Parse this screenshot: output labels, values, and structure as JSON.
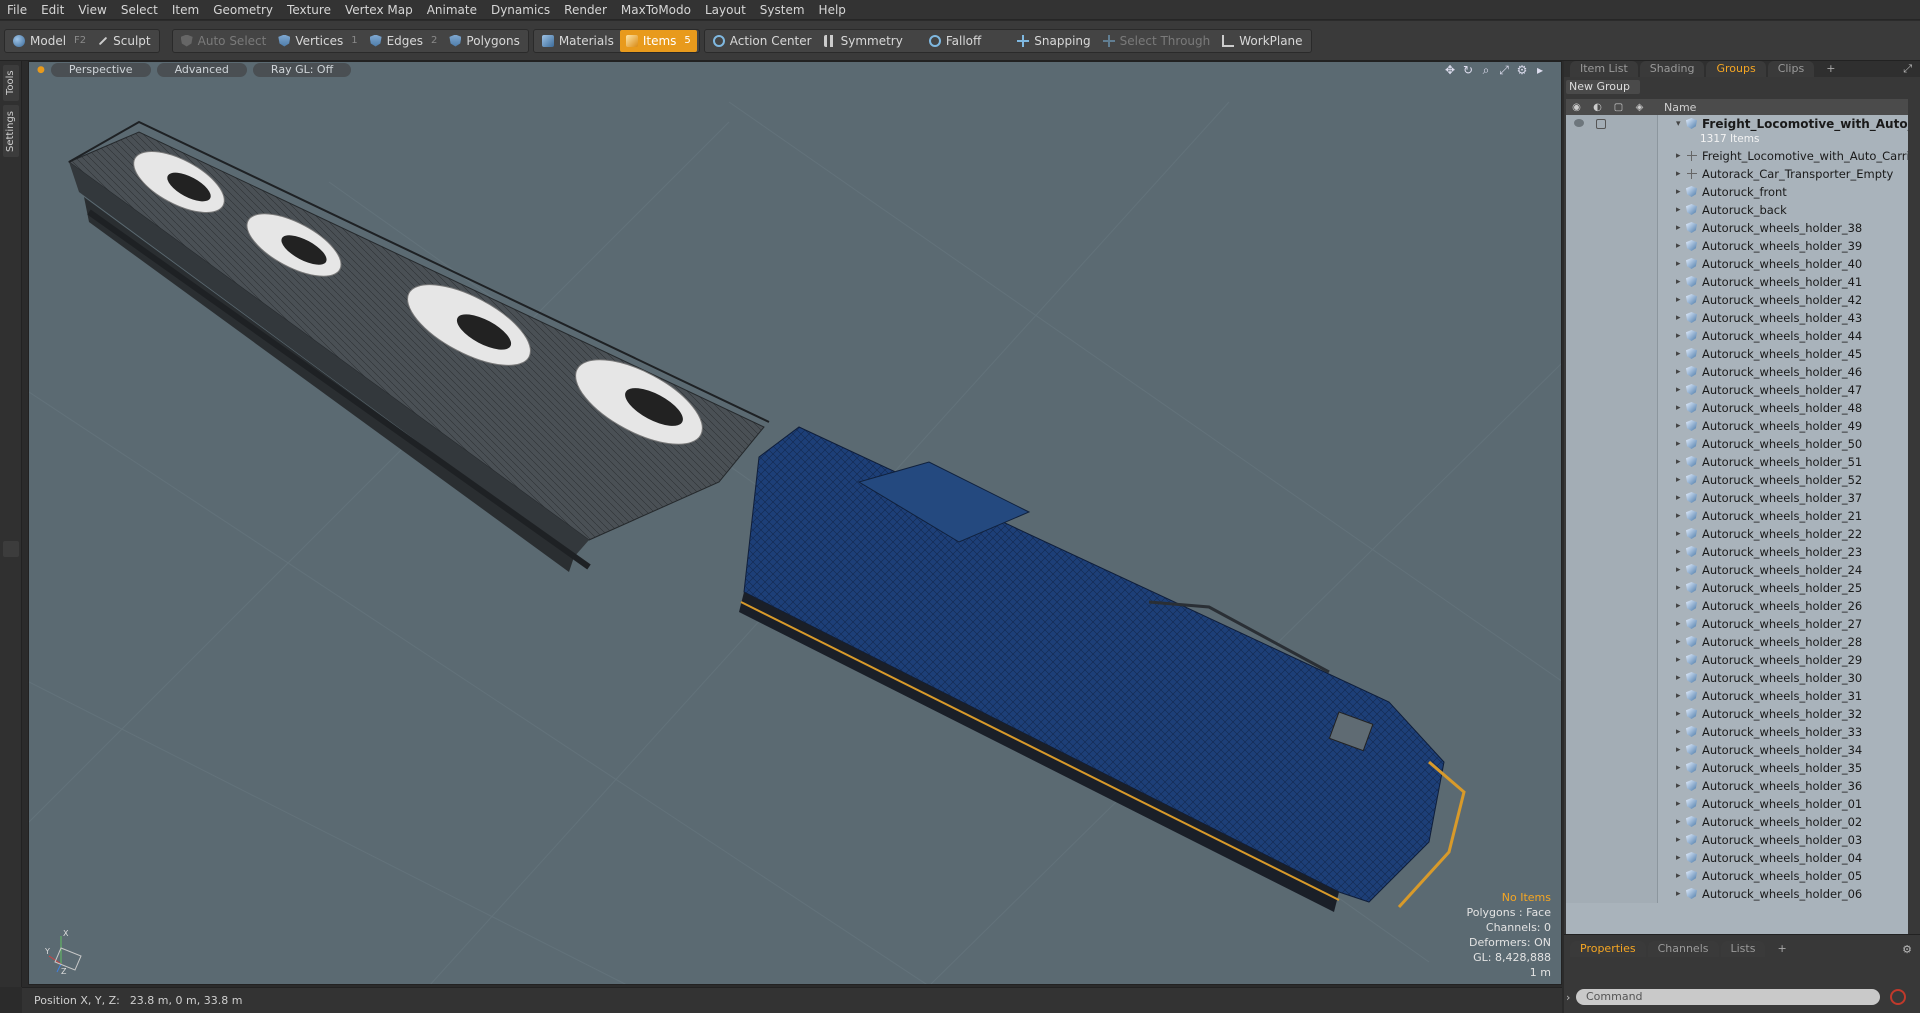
{
  "menu": [
    "File",
    "Edit",
    "View",
    "Select",
    "Item",
    "Geometry",
    "Texture",
    "Vertex Map",
    "Animate",
    "Dynamics",
    "Render",
    "MaxToModo",
    "Layout",
    "System",
    "Help"
  ],
  "toolbar": {
    "model": "Model",
    "model_key": "F2",
    "sculpt": "Sculpt",
    "auto_select": "Auto Select",
    "vertices": "Vertices",
    "vertices_key": "1",
    "edges": "Edges",
    "edges_key": "2",
    "polygons": "Polygons",
    "materials": "Materials",
    "items": "Items",
    "items_key": "5",
    "action_center": "Action Center",
    "symmetry": "Symmetry",
    "falloff": "Falloff",
    "snapping": "Snapping",
    "select_through": "Select Through",
    "workplane": "WorkPlane"
  },
  "left_tabs": {
    "tools": "Tools",
    "settings": "Settings"
  },
  "viewport": {
    "tabs": [
      "Perspective",
      "Advanced",
      "Ray GL: Off"
    ],
    "info": {
      "items": "No Items",
      "polygons": "Polygons : Face",
      "channels": "Channels: 0",
      "deformers": "Deformers: ON",
      "gl": "GL: 8,428,888",
      "scale": "1 m"
    },
    "axes": {
      "x": "X",
      "y": "Y",
      "z": "Z"
    }
  },
  "status": {
    "label": "Position X, Y, Z:",
    "value": "23.8 m, 0 m, 33.8 m"
  },
  "right_panel": {
    "tabs": [
      "Item List",
      "Shading",
      "Groups",
      "Clips"
    ],
    "active_tab": "Groups",
    "new_group": "New Group",
    "column_name": "Name",
    "root": {
      "name": "Freight_Locomotive_with_Auto_C ...",
      "count": "1317 Items"
    },
    "items": [
      {
        "name": "Freight_Locomotive_with_Auto_Carrie...",
        "icon": "locator"
      },
      {
        "name": "Autorack_Car_Transporter_Empty",
        "icon": "locator"
      },
      {
        "name": "Autoruck_front",
        "icon": "mesh"
      },
      {
        "name": "Autoruck_back",
        "icon": "mesh"
      },
      {
        "name": "Autoruck_wheels_holder_38",
        "icon": "mesh"
      },
      {
        "name": "Autoruck_wheels_holder_39",
        "icon": "mesh"
      },
      {
        "name": "Autoruck_wheels_holder_40",
        "icon": "mesh"
      },
      {
        "name": "Autoruck_wheels_holder_41",
        "icon": "mesh"
      },
      {
        "name": "Autoruck_wheels_holder_42",
        "icon": "mesh"
      },
      {
        "name": "Autoruck_wheels_holder_43",
        "icon": "mesh"
      },
      {
        "name": "Autoruck_wheels_holder_44",
        "icon": "mesh"
      },
      {
        "name": "Autoruck_wheels_holder_45",
        "icon": "mesh"
      },
      {
        "name": "Autoruck_wheels_holder_46",
        "icon": "mesh"
      },
      {
        "name": "Autoruck_wheels_holder_47",
        "icon": "mesh"
      },
      {
        "name": "Autoruck_wheels_holder_48",
        "icon": "mesh"
      },
      {
        "name": "Autoruck_wheels_holder_49",
        "icon": "mesh"
      },
      {
        "name": "Autoruck_wheels_holder_50",
        "icon": "mesh"
      },
      {
        "name": "Autoruck_wheels_holder_51",
        "icon": "mesh"
      },
      {
        "name": "Autoruck_wheels_holder_52",
        "icon": "mesh"
      },
      {
        "name": "Autoruck_wheels_holder_37",
        "icon": "mesh"
      },
      {
        "name": "Autoruck_wheels_holder_21",
        "icon": "mesh"
      },
      {
        "name": "Autoruck_wheels_holder_22",
        "icon": "mesh"
      },
      {
        "name": "Autoruck_wheels_holder_23",
        "icon": "mesh"
      },
      {
        "name": "Autoruck_wheels_holder_24",
        "icon": "mesh"
      },
      {
        "name": "Autoruck_wheels_holder_25",
        "icon": "mesh"
      },
      {
        "name": "Autoruck_wheels_holder_26",
        "icon": "mesh"
      },
      {
        "name": "Autoruck_wheels_holder_27",
        "icon": "mesh"
      },
      {
        "name": "Autoruck_wheels_holder_28",
        "icon": "mesh"
      },
      {
        "name": "Autoruck_wheels_holder_29",
        "icon": "mesh"
      },
      {
        "name": "Autoruck_wheels_holder_30",
        "icon": "mesh"
      },
      {
        "name": "Autoruck_wheels_holder_31",
        "icon": "mesh"
      },
      {
        "name": "Autoruck_wheels_holder_32",
        "icon": "mesh"
      },
      {
        "name": "Autoruck_wheels_holder_33",
        "icon": "mesh"
      },
      {
        "name": "Autoruck_wheels_holder_34",
        "icon": "mesh"
      },
      {
        "name": "Autoruck_wheels_holder_35",
        "icon": "mesh"
      },
      {
        "name": "Autoruck_wheels_holder_36",
        "icon": "mesh"
      },
      {
        "name": "Autoruck_wheels_holder_01",
        "icon": "mesh"
      },
      {
        "name": "Autoruck_wheels_holder_02",
        "icon": "mesh"
      },
      {
        "name": "Autoruck_wheels_holder_03",
        "icon": "mesh"
      },
      {
        "name": "Autoruck_wheels_holder_04",
        "icon": "mesh"
      },
      {
        "name": "Autoruck_wheels_holder_05",
        "icon": "mesh"
      },
      {
        "name": "Autoruck_wheels_holder_06",
        "icon": "mesh"
      }
    ],
    "bottom_tabs": [
      "Properties",
      "Channels",
      "Lists"
    ],
    "command_placeholder": "Command"
  },
  "colors": {
    "accent": "#e89a1c",
    "viewport_bg": "#5b6a72",
    "locomotive": "#1d3f78",
    "list_bg": "#a9b3bb"
  }
}
